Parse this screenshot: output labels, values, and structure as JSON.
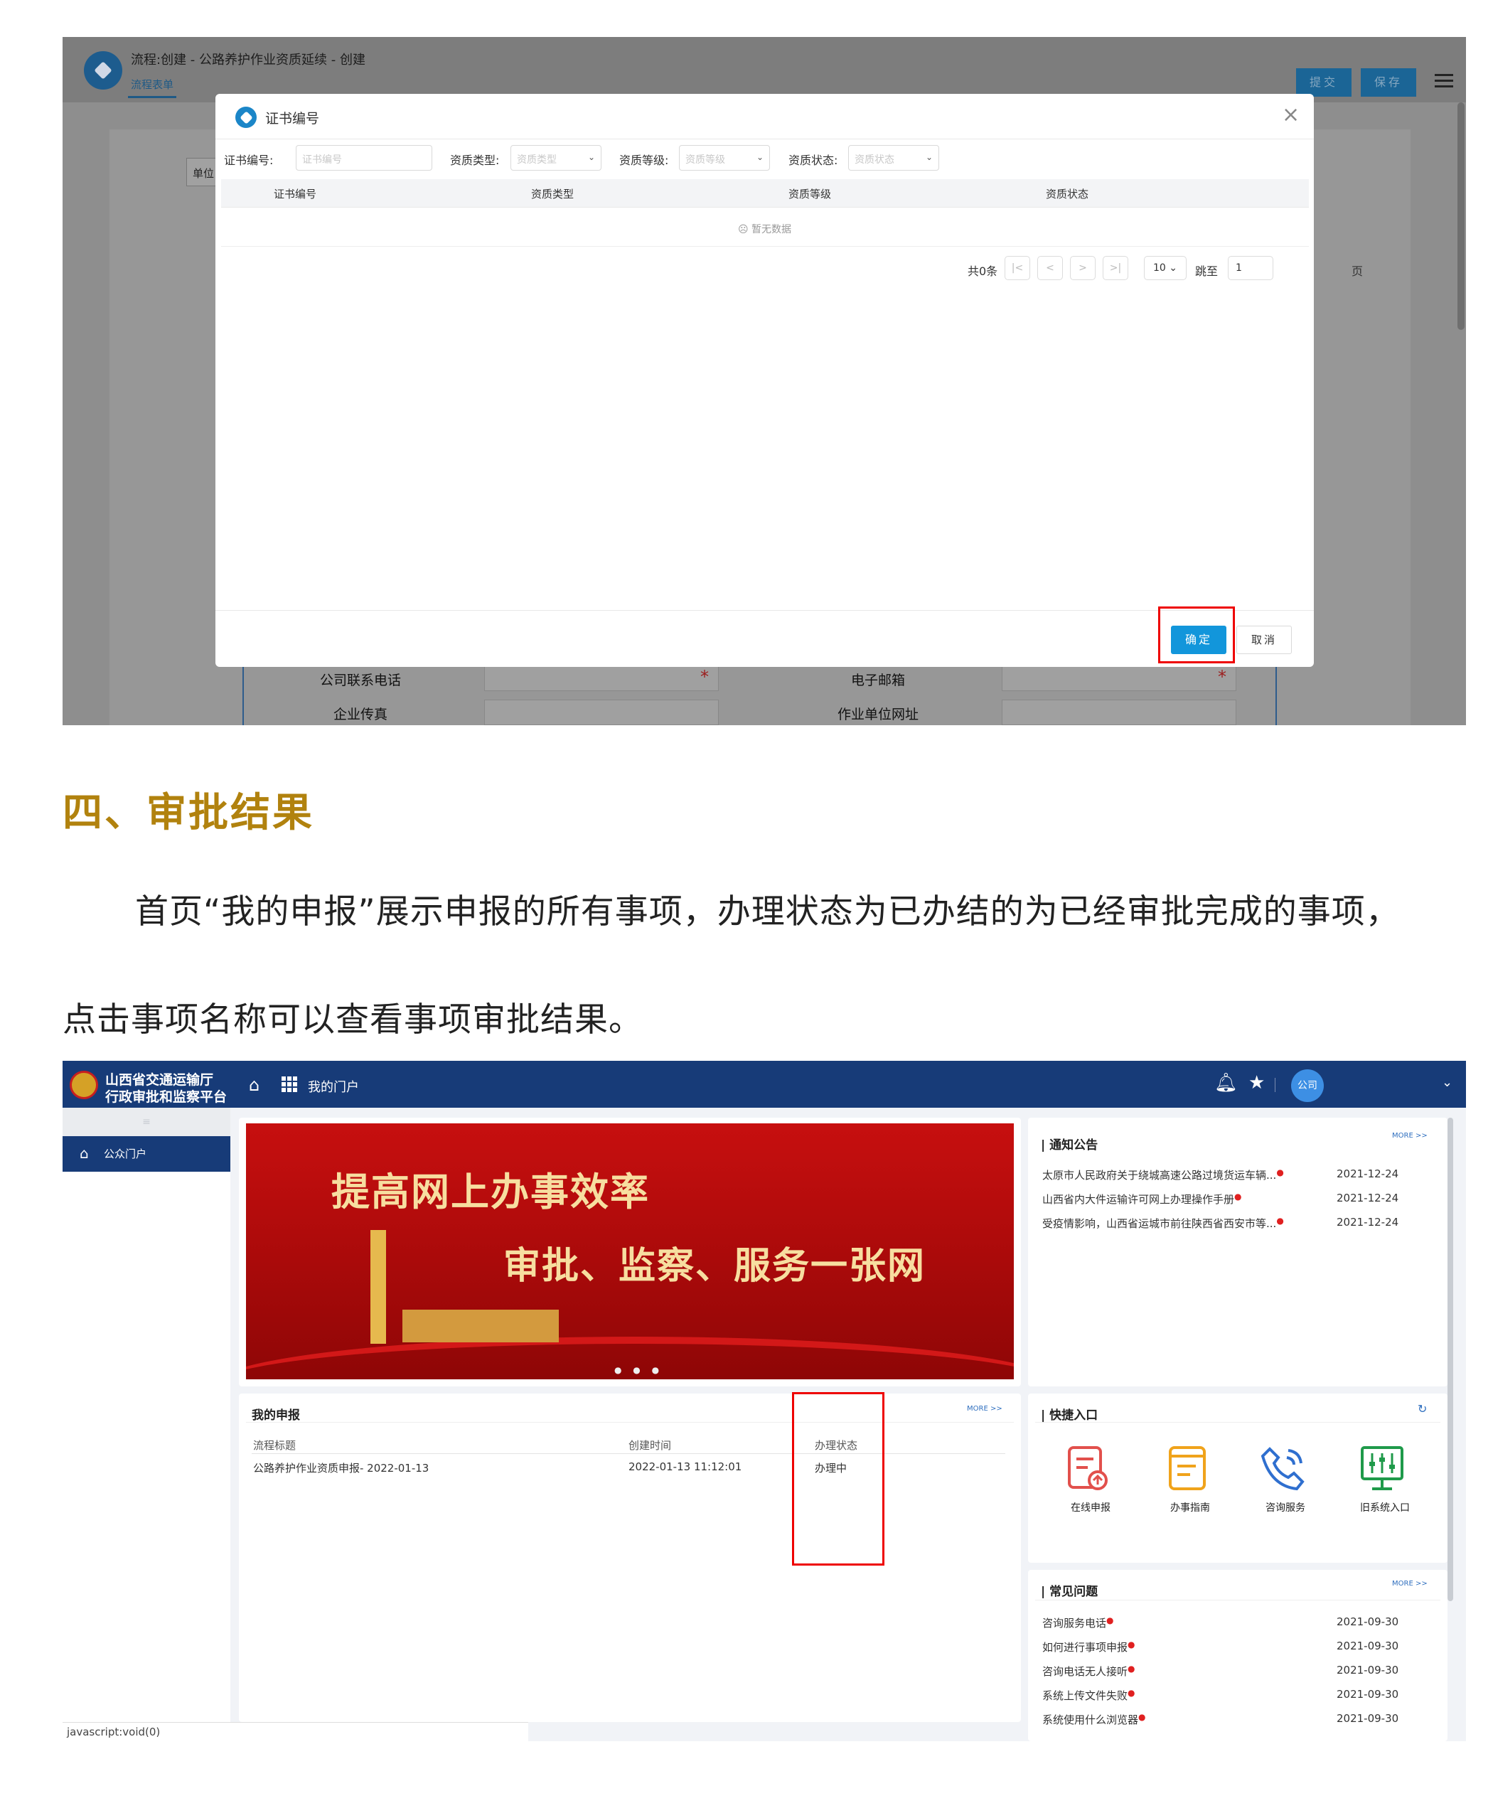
{
  "screenshot1": {
    "title": "流程:创建 - 公路养护作业资质延续 - 创建",
    "subtab": "流程表单",
    "submit_label": "提交",
    "save_label": "保存",
    "bg_tab_label": "单位",
    "bg_fields": {
      "phone_label": "公司联系电话",
      "email_label": "电子邮箱",
      "fax_label": "企业传真",
      "website_label": "作业单位网址",
      "required_mark": "*"
    },
    "modal": {
      "title": "证书编号",
      "close": "×",
      "filters": [
        {
          "label": "证书编号:",
          "placeholder": "证书编号"
        },
        {
          "label": "资质类型:",
          "placeholder": "资质类型"
        },
        {
          "label": "资质等级:",
          "placeholder": "资质等级"
        },
        {
          "label": "资质状态:",
          "placeholder": "资质状态"
        }
      ],
      "columns": [
        "证书编号",
        "资质类型",
        "资质等级",
        "资质状态"
      ],
      "empty_text": "☹ 暂无数据",
      "pager": {
        "total": "共0条",
        "first": "|<",
        "prev": "<",
        "next": ">",
        "last": ">|",
        "page_size": "10",
        "jump_label": "跳至",
        "page": "1",
        "page_unit": "页"
      },
      "ok_label": "确定",
      "cancel_label": "取消"
    }
  },
  "section": {
    "heading": "四、审批结果",
    "para_line1": "首页“我的申报”展示申报的所有事项，办理状态为已办结的为已经审批完成的事项，",
    "para_line2": "点击事项名称可以查看事项审批结果。"
  },
  "screenshot2": {
    "brand_line1": "山西省交通运输厅",
    "brand_line2": "行政审批和监察平台",
    "portal_label": "我的门户",
    "avatar_text": "公司",
    "sidebar_top": "≡",
    "sidebar_item": "公众门户",
    "status_bar": "javascript:void(0)",
    "banner": {
      "line1": "提高网上办事效率",
      "line2": "审批、监察、服务一张网"
    },
    "more_label": "MORE >>",
    "notices": {
      "title": "通知公告",
      "items": [
        {
          "text": "太原市人民政府关于绕城高速公路过境货运车辆...",
          "date": "2021-12-24"
        },
        {
          "text": "山西省内大件运输许可网上办理操作手册",
          "date": "2021-12-24"
        },
        {
          "text": "受疫情影响，山西省运城市前往陕西省西安市等...",
          "date": "2021-12-24"
        }
      ]
    },
    "my_reports": {
      "title": "我的申报",
      "columns": [
        "流程标题",
        "创建时间",
        "办理状态"
      ],
      "rows": [
        {
          "title": "公路养护作业资质申报- 2022-01-13",
          "created": "2022-01-13 11:12:01",
          "status": "办理中"
        }
      ]
    },
    "quick": {
      "title": "快捷入口",
      "items": [
        "在线申报",
        "办事指南",
        "咨询服务",
        "旧系统入口"
      ]
    },
    "faq": {
      "title": "常见问题",
      "items": [
        {
          "text": "咨询服务电话",
          "date": "2021-09-30"
        },
        {
          "text": "如何进行事项申报",
          "date": "2021-09-30"
        },
        {
          "text": "咨询电话无人接听",
          "date": "2021-09-30"
        },
        {
          "text": "系统上传文件失败",
          "date": "2021-09-30"
        },
        {
          "text": "系统使用什么浏览器",
          "date": "2021-09-30"
        }
      ]
    }
  }
}
